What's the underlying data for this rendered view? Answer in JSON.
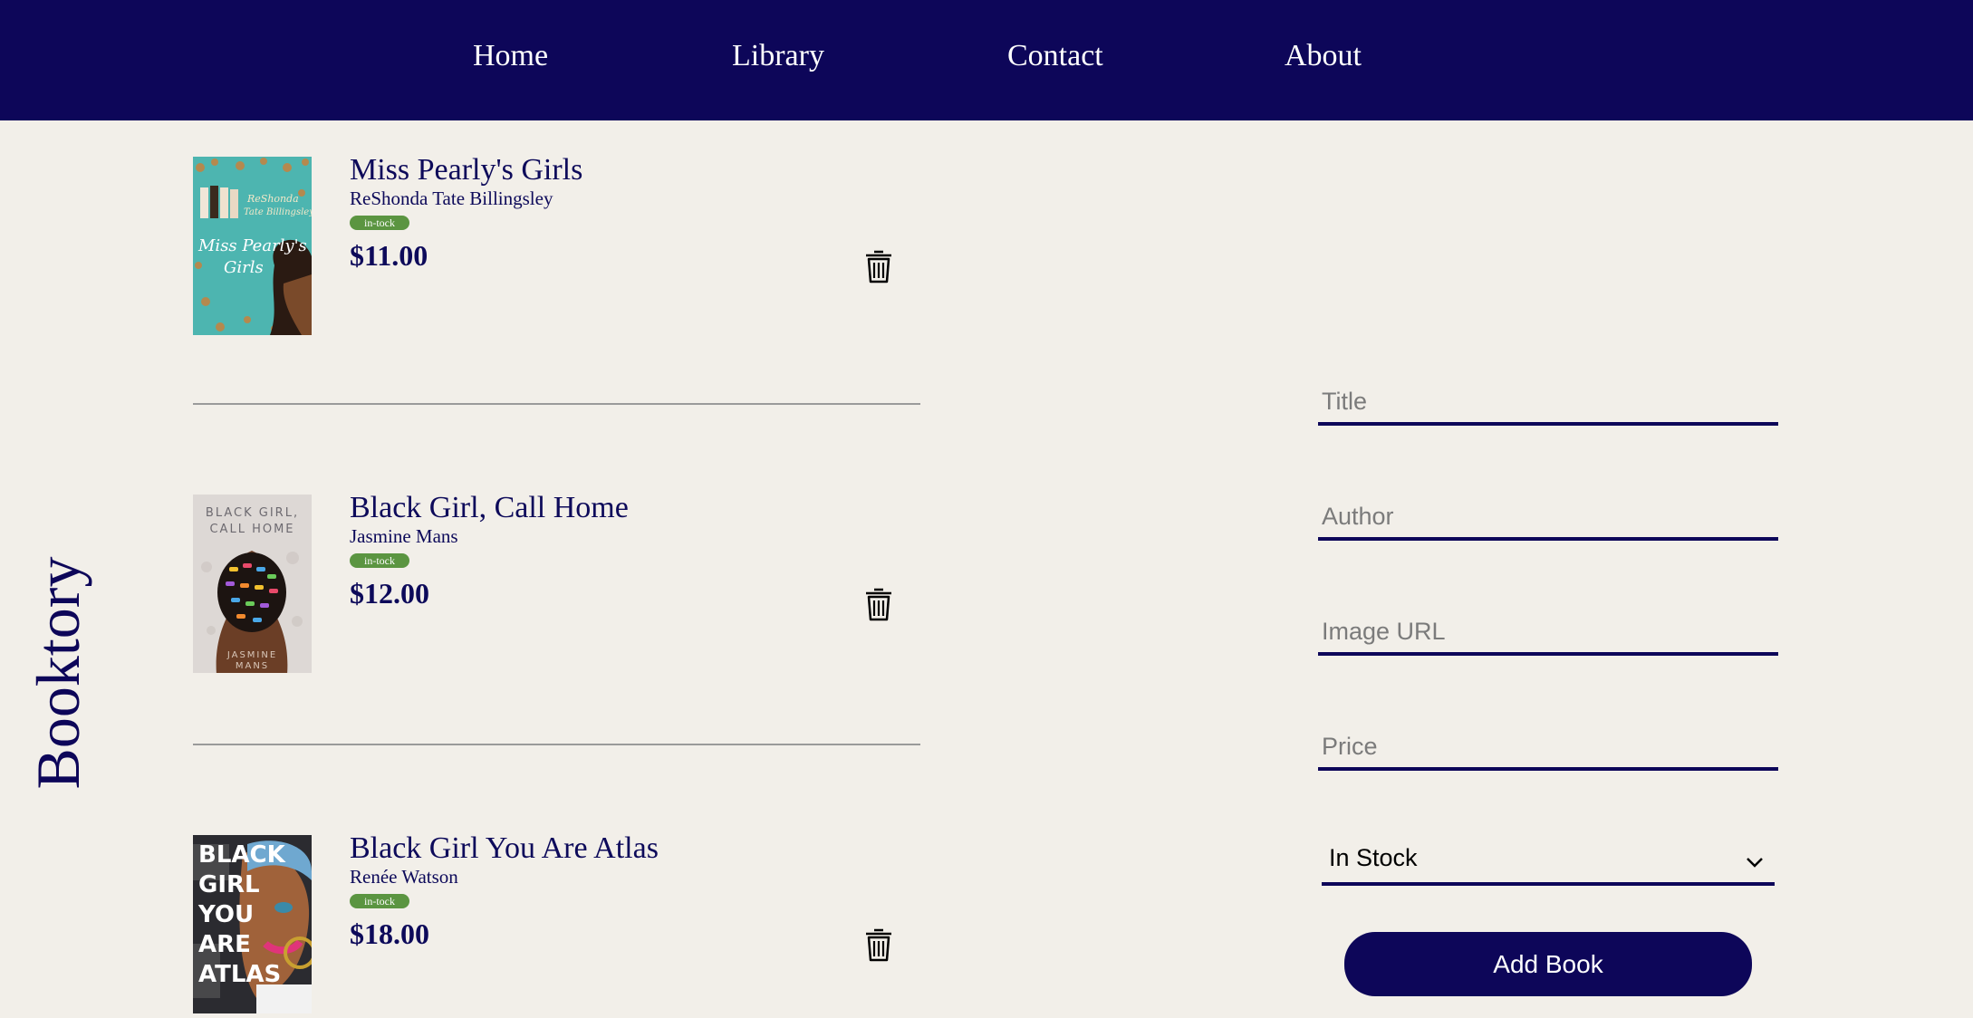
{
  "nav": {
    "links": [
      "Home",
      "Library",
      "Contact",
      "About"
    ]
  },
  "brand": "Booktory",
  "books": [
    {
      "title": "Miss Pearly's Girls",
      "author": "ReShonda Tate Billingsley",
      "status": "in-tock",
      "price": "$11.00"
    },
    {
      "title": "Black Girl, Call Home",
      "author": "Jasmine Mans",
      "status": "in-tock",
      "price": "$12.00"
    },
    {
      "title": "Black Girl You Are Atlas",
      "author": "Renée Watson",
      "status": "in-tock",
      "price": "$18.00"
    }
  ],
  "covers": {
    "0": {
      "author_line1": "ReShonda",
      "author_line2": "Tate Billingsley",
      "title_line1": "Miss Pearly's",
      "title_line2": "Girls"
    },
    "1": {
      "title_line1": "BLACK GIRL,",
      "title_line2": "CALL HOME",
      "author_line1": "JASMINE",
      "author_line2": "MANS"
    },
    "2": {
      "words": [
        "BLACK",
        "GIRL",
        "YOU",
        "ARE",
        "ATLAS"
      ]
    }
  },
  "form": {
    "title_placeholder": "Title",
    "author_placeholder": "Author",
    "image_url_placeholder": "Image URL",
    "price_placeholder": "Price",
    "stock_selected": "In Stock",
    "submit_label": "Add Book"
  },
  "colors": {
    "navy": "#0d0659",
    "background": "#f2efe9",
    "badge_green": "#5b9541",
    "divider": "#9a9a9a"
  },
  "icons": [
    "trash-icon",
    "chevron-down-icon"
  ]
}
